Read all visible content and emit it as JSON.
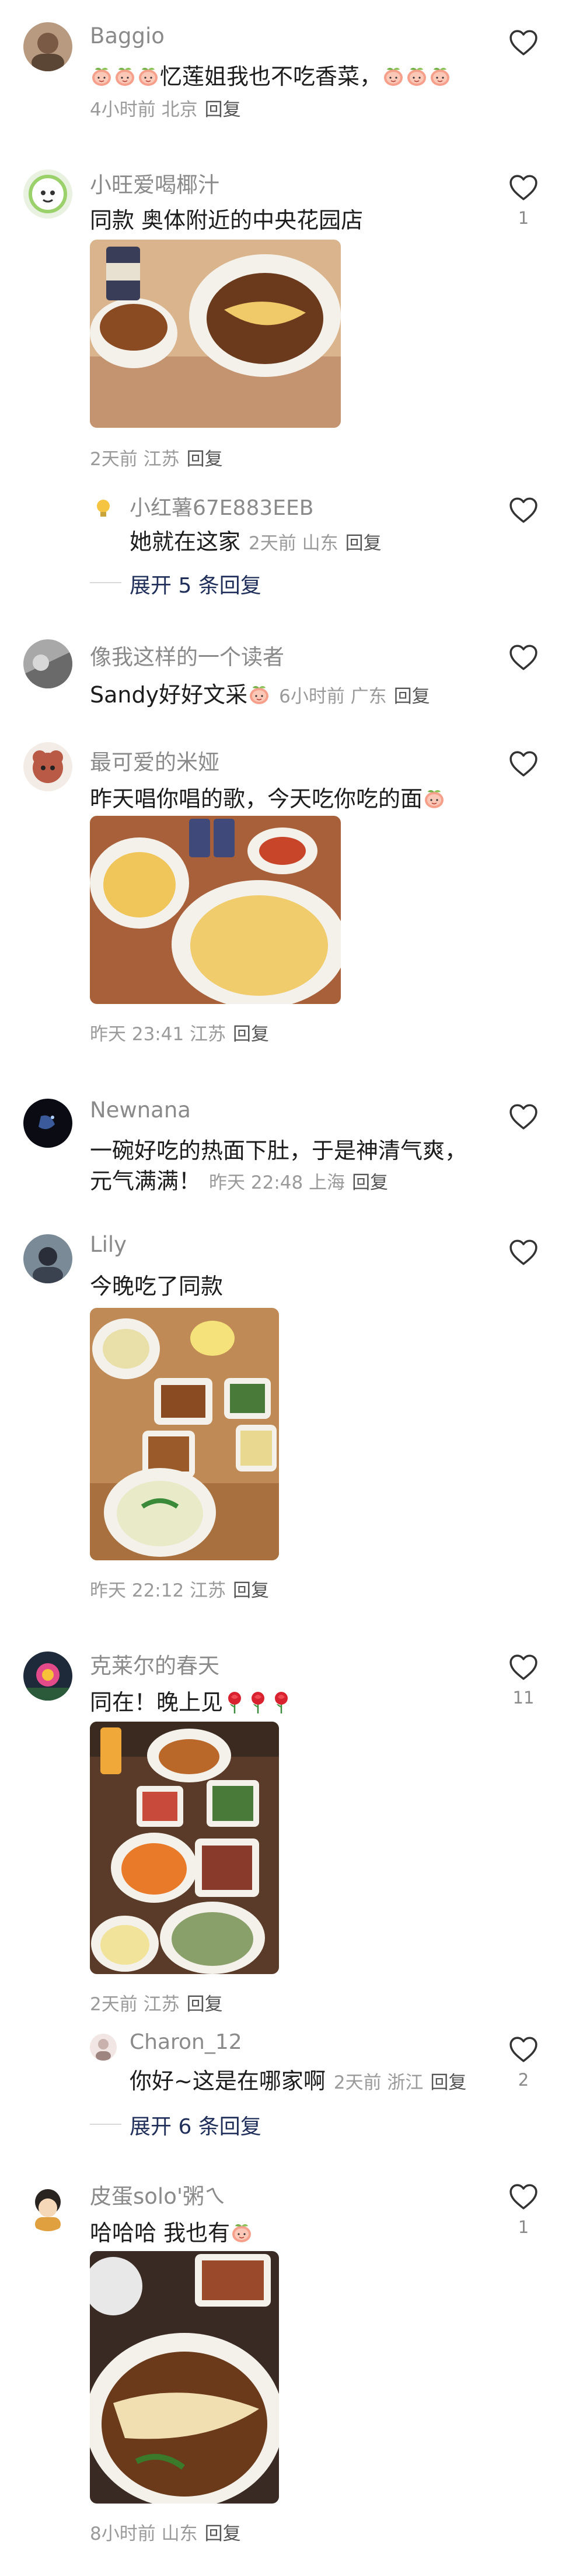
{
  "comments": [
    {
      "name": "Baggio",
      "text": "忆莲姐我也不吃香菜，",
      "meta": "4小时前 北京",
      "reply": "回复",
      "likes": ""
    },
    {
      "name": "小旺爱喝椰汁",
      "text": "同款 奥体附近的中央花园店",
      "meta": "2天前 江苏",
      "reply": "回复",
      "likes": "1",
      "sub": {
        "name": "小红薯67E883EEB",
        "text": "她就在这家",
        "meta": "2天前 山东",
        "reply": "回复"
      },
      "expand": "展开 5 条回复"
    },
    {
      "name": "像我这样的一个读者",
      "text": "Sandy好好文采",
      "meta": "6小时前 广东",
      "reply": "回复"
    },
    {
      "name": "最可爱的米娅",
      "text": "昨天唱你唱的歌，今天吃你吃的面",
      "meta": "昨天 23:41 江苏",
      "reply": "回复"
    },
    {
      "name": "Newnana",
      "text_line1": "一碗好吃的热面下肚，于是神清气爽，",
      "text_line2": "元气满满！",
      "meta": "昨天 22:48 上海",
      "reply": "回复"
    },
    {
      "name": "Lily",
      "text": "今晚吃了同款",
      "meta": "昨天 22:12 江苏",
      "reply": "回复"
    },
    {
      "name": "克莱尔的春天",
      "text": "同在！晚上见",
      "meta": "2天前 江苏",
      "reply": "回复",
      "likes": "11",
      "sub": {
        "name": "Charon_12",
        "text": "你好~这是在哪家啊",
        "meta": "2天前 浙江",
        "reply": "回复",
        "likes": "2"
      },
      "expand": "展开 6 条回复"
    },
    {
      "name": "皮蛋solo'粥ㄟ",
      "text": "哈哈哈 我也有",
      "meta": "8小时前 山东",
      "reply": "回复",
      "likes": "1"
    }
  ],
  "colors": {
    "accent_link": "#1f2f5a",
    "meta": "#9a9a9a",
    "name": "#8a8a8a",
    "text": "#1c1c1c"
  }
}
